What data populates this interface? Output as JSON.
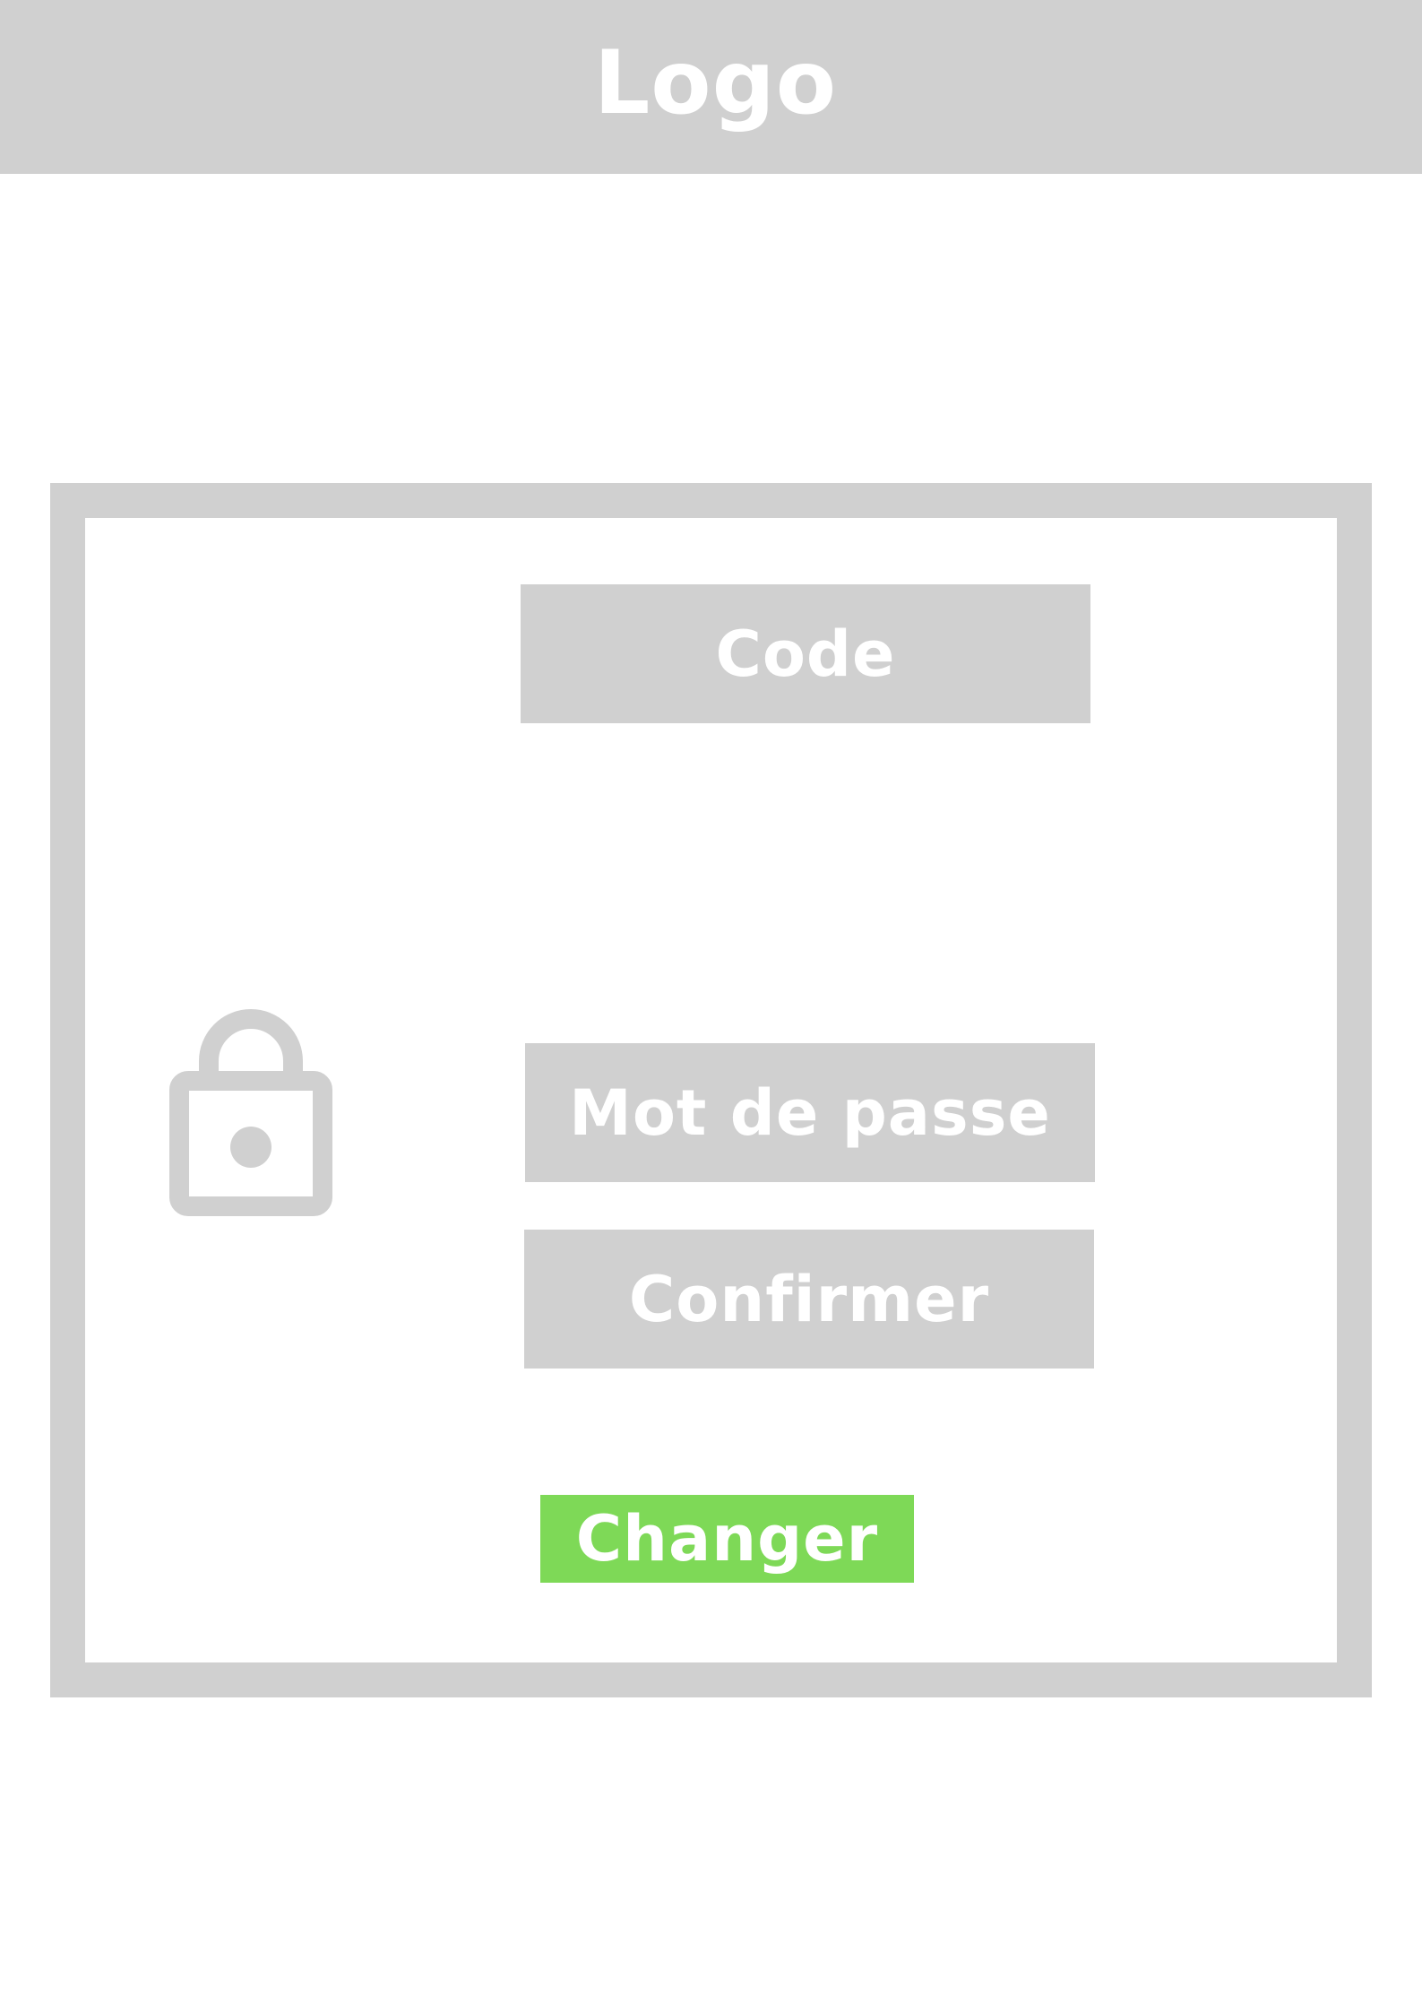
{
  "header": {
    "logo": "Logo"
  },
  "form": {
    "code_placeholder": "Code",
    "password_placeholder": "Mot de passe",
    "confirm_placeholder": "Confirmer",
    "submit_label": "Changer"
  },
  "icons": {
    "lock": "lock-icon"
  },
  "colors": {
    "gray": "#d0d0d0",
    "accent_green": "#7ed957",
    "text": "#ffffff"
  }
}
